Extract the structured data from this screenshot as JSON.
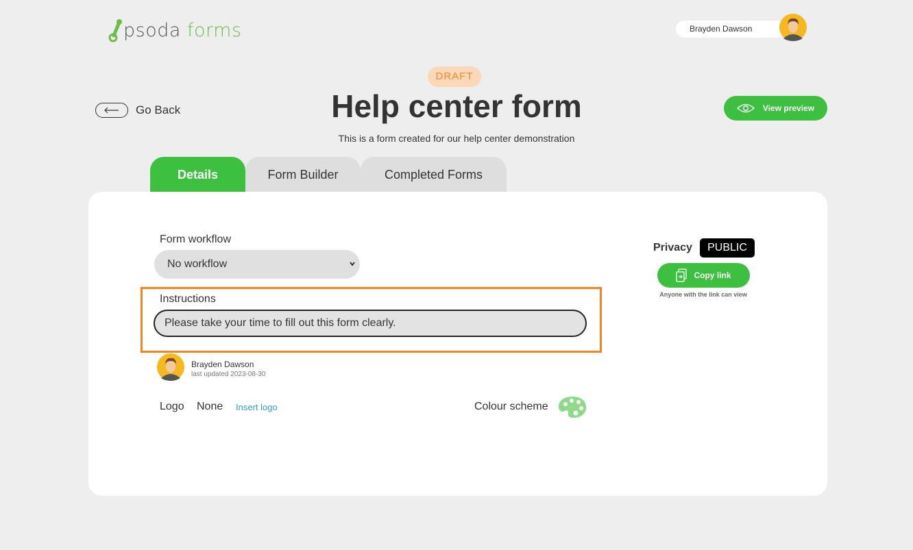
{
  "app": {
    "logo_text_left": "psoda",
    "logo_text_right": "forms",
    "brand_green": "#3dbf3f",
    "accent_orange": "#f5841f"
  },
  "header": {
    "user_name": "Brayden Dawson",
    "avatar_icon": "user-avatar-icon"
  },
  "form": {
    "status_badge": "DRAFT",
    "title": "Help center form",
    "description": "This is a form created for our help center demonstration",
    "go_back_label": "Go Back",
    "view_preview_label": "View preview"
  },
  "tabs": [
    {
      "label": "Details",
      "active": true
    },
    {
      "label": "Form Builder",
      "active": false
    },
    {
      "label": "Completed Forms",
      "active": false
    }
  ],
  "details": {
    "workflow_label": "Form workflow",
    "workflow_value": "No workflow",
    "instructions_label": "Instructions",
    "instructions_value": "Please take your time to fill out this form clearly.",
    "author_name": "Brayden Dawson",
    "last_updated": "last updated 2023-08-30",
    "logo_label": "Logo",
    "logo_value": "None",
    "insert_logo_label": "Insert logo",
    "colour_scheme_label": "Colour scheme"
  },
  "privacy": {
    "label": "Privacy",
    "value": "PUBLIC",
    "copy_link_label": "Copy link",
    "hint": "Anyone with the link can view"
  }
}
